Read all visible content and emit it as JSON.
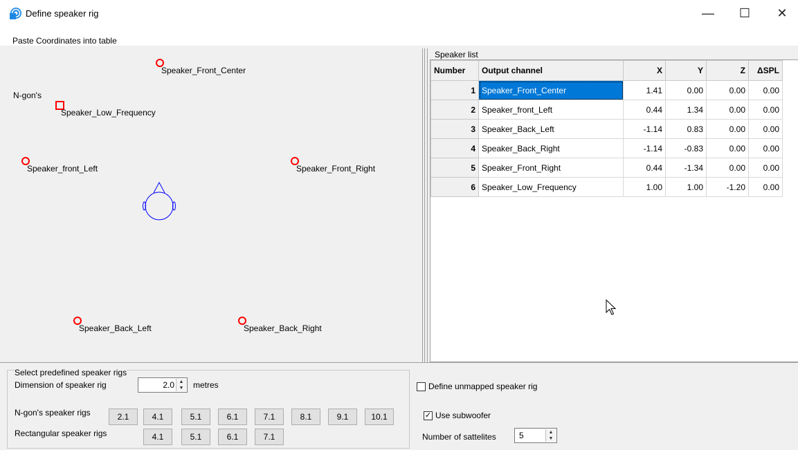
{
  "window": {
    "title": "Define speaker rig",
    "minimize": "—",
    "maximize": "☐",
    "close": "✕"
  },
  "menu": {
    "paste": "Paste Coordinates into table"
  },
  "canvas": {
    "ngon_label": "N-gon's",
    "speakers": [
      {
        "label": "Speaker_Front_Center",
        "marker": "circle"
      },
      {
        "label": "Speaker_Low_Frequency",
        "marker": "square"
      },
      {
        "label": "Speaker_front_Left",
        "marker": "circle"
      },
      {
        "label": "Speaker_Front_Right",
        "marker": "circle"
      },
      {
        "label": "Speaker_Back_Left",
        "marker": "circle"
      },
      {
        "label": "Speaker_Back_Right",
        "marker": "circle"
      }
    ],
    "marker_color": "#ff0000",
    "listener_color": "#0000ff"
  },
  "speaker_list": {
    "caption": "Speaker list",
    "columns": [
      "Number",
      "Output channel",
      "X",
      "Y",
      "Z",
      "ΔSPL"
    ],
    "rows": [
      {
        "num": "1",
        "channel": "Speaker_Front_Center",
        "x": "1.41",
        "y": "0.00",
        "z": "0.00",
        "spl": "0.00"
      },
      {
        "num": "2",
        "channel": "Speaker_front_Left",
        "x": "0.44",
        "y": "1.34",
        "z": "0.00",
        "spl": "0.00"
      },
      {
        "num": "3",
        "channel": "Speaker_Back_Left",
        "x": "-1.14",
        "y": "0.83",
        "z": "0.00",
        "spl": "0.00"
      },
      {
        "num": "4",
        "channel": "Speaker_Back_Right",
        "x": "-1.14",
        "y": "-0.83",
        "z": "0.00",
        "spl": "0.00"
      },
      {
        "num": "5",
        "channel": "Speaker_Front_Right",
        "x": "0.44",
        "y": "-1.34",
        "z": "0.00",
        "spl": "0.00"
      },
      {
        "num": "6",
        "channel": "Speaker_Low_Frequency",
        "x": "1.00",
        "y": "1.00",
        "z": "-1.20",
        "spl": "0.00"
      }
    ],
    "selected_color": "#0078d7"
  },
  "predefined": {
    "title": "Select predefined speaker rigs",
    "dimension_label": "Dimension of speaker rig",
    "dimension_value": "2.0",
    "dimension_unit": "metres",
    "ngon_label": "N-gon's speaker rigs",
    "ngon_buttons": [
      "2.1",
      "4.1",
      "5.1",
      "6.1",
      "7.1",
      "8.1",
      "9.1",
      "10.1"
    ],
    "rect_label": "Rectangular speaker rigs",
    "rect_buttons": [
      "4.1",
      "5.1",
      "6.1",
      "7.1"
    ]
  },
  "options": {
    "unmapped_label": "Define unmapped speaker rig",
    "unmapped_checked": false,
    "subwoofer_label": "Use subwoofer",
    "subwoofer_checked": true,
    "satellites_label": "Number of sattelites",
    "satellites_value": "5"
  }
}
